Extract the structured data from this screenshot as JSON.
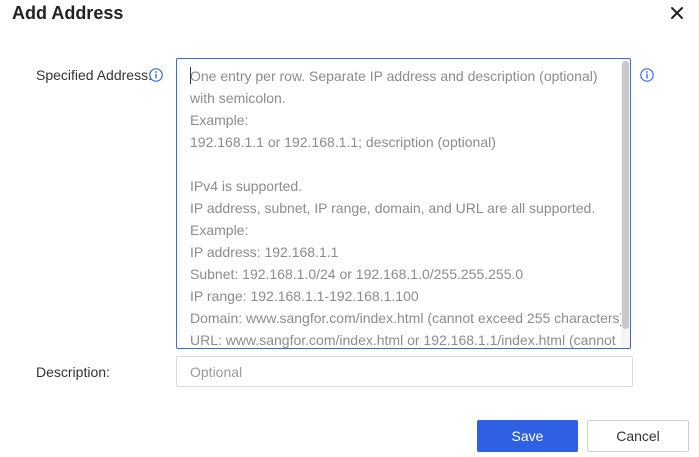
{
  "dialog": {
    "title": "Add Address",
    "close_icon": "close-icon"
  },
  "form": {
    "specified_address": {
      "label": "Specified Address:",
      "info_icon": "info-icon",
      "placeholder_lines": [
        "One entry per row. Separate IP address and description (optional)",
        "with semicolon.",
        "Example:",
        "192.168.1.1 or 192.168.1.1; description (optional)",
        "",
        "IPv4 is supported.",
        "IP address, subnet, IP range, domain, and URL are all supported.",
        "Example:",
        "IP address: 192.168.1.1",
        "Subnet: 192.168.1.0/24 or 192.168.1.0/255.255.255.0",
        "IP range: 192.168.1.1-192.168.1.100",
        "Domain: www.sangfor.com/index.html (cannot exceed 255 characters)",
        "URL: www.sangfor.com/index.html or 192.168.1.1/index.html (cannot"
      ],
      "value": ""
    },
    "description": {
      "label": "Description:",
      "placeholder": "Optional",
      "value": ""
    }
  },
  "buttons": {
    "save_label": "Save",
    "cancel_label": "Cancel"
  },
  "colors": {
    "primary": "#2f5fe3",
    "focus_border": "#3b6cd4",
    "info_icon": "#2f6ee6",
    "text": "#333333",
    "placeholder": "#8c8c8c"
  }
}
